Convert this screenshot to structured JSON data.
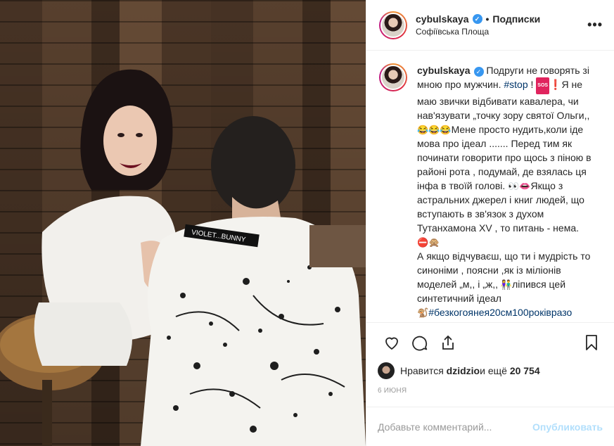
{
  "post": {
    "username": "cybulskaya",
    "follow_separator": "•",
    "follow_label": "Подписки",
    "location": "Софіївська Площа",
    "more_label": "•••",
    "shirt_text": "VIOLET...BUNNY"
  },
  "caption": {
    "username": "cybulskaya",
    "p1": "Подруги не говорять зі мною про мужчин. ",
    "tag1": "#stop",
    "p2": " ! ",
    "sos": "SOS",
    "excl": "❗",
    "p3": "Я не маю звички відбивати кавалера, чи нав'язувати „точку зору святої Ольги,,",
    "emoji1": "😂😂😂",
    "p4": "Мене просто нудить,коли іде мова про ідеал ....... Перед тим як починати говорити про щось з піною в районі рота , подумай, де взялась ця інфа в твоїй голові. ",
    "emoji2": "👀👄",
    "p5": "Якщо з астральних джерел і книг людей, що вступають в зв'язок з духом Тутанхамона XV , то питань - нема. ",
    "emoji3": "⛔🙊",
    "p6": "А якщо відчуваєш, що ти і мудрість то синоніми , поясни ,як із міліонів моделей „м,, і „ж,, ",
    "emoji4": "👫",
    "p7": "ліпився цей синтетичний ідеал",
    "emoji5": "🐒",
    "tag2": "#безкогоянея20см100роківразо місмертьводиндень",
    "p8": " ? ",
    "emoji6": "🙈🙉🙊"
  },
  "actions": {
    "like_icon": "heart-icon",
    "comment_icon": "comment-icon",
    "share_icon": "share-icon",
    "save_icon": "bookmark-icon"
  },
  "likes": {
    "prefix": "Нравится ",
    "user": "dzidzio",
    "middle": " и ещё ",
    "count": "20 754"
  },
  "date": "6 июня",
  "comment_box": {
    "placeholder": "Добавьте комментарий...",
    "publish_label": "Опубликовать"
  },
  "colors": {
    "link": "#003569",
    "verified": "#3897f0",
    "publish_disabled": "#b2dffc",
    "muted": "#999999"
  }
}
